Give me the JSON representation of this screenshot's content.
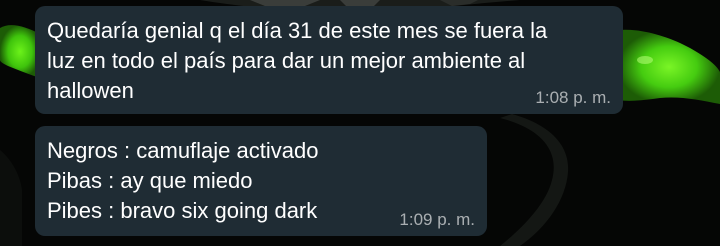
{
  "chat": {
    "messages": [
      {
        "lines": [
          "Quedaría genial q el día 31 de este mes se fuera la",
          "luz en todo el país para dar un mejor ambiente al",
          "hallowen"
        ],
        "time": "1:08 p. m."
      },
      {
        "lines": [
          "Negros : camuflaje activado",
          "Pibas : ay que miedo",
          "Pibes : bravo six going dark"
        ],
        "time": "1:09 p. m."
      }
    ]
  },
  "colors": {
    "background": "#050605",
    "wallpaper_accent": "#4ee012",
    "bubble": "#1f2c34",
    "text": "#ffffff",
    "timestamp": "#a0a6aa"
  }
}
